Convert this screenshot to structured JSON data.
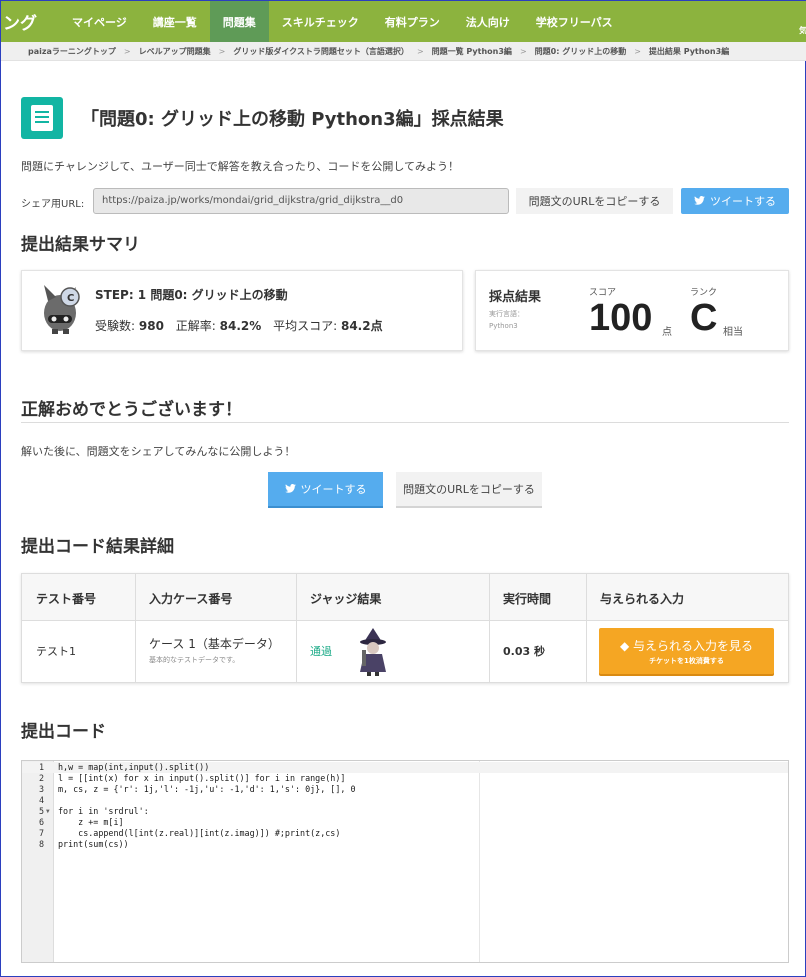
{
  "nav": {
    "logo": "ング",
    "items": [
      "マイページ",
      "講座一覧",
      "問題集",
      "スキルチェック",
      "有料プラン",
      "法人向け",
      "学校フリーパス"
    ],
    "active_index": 2,
    "right_text": "気"
  },
  "breadcrumb": [
    "paizaラーニングトップ",
    "レベルアップ問題集",
    "グリッド版ダイクストラ問題セット（言語選択）",
    "問題一覧 Python3編",
    "問題0: グリッド上の移動",
    "提出結果 Python3編"
  ],
  "title": "「問題0: グリッド上の移動 Python3編」採点結果",
  "intro": "問題にチャレンジして、ユーザー同士で解答を教え合ったり、コードを公開してみよう！",
  "share": {
    "label": "シェア用URL:",
    "url": "https://paiza.jp/works/mondai/grid_dijkstra/grid_dijkstra__d0",
    "copy_label": "問題文のURLをコピーする",
    "tweet_label": "ツイートする"
  },
  "summary": {
    "heading": "提出結果サマリ",
    "step_title": "STEP: 1 問題0: グリッド上の移動",
    "examinees_label": "受験数:",
    "examinees": "980",
    "accuracy_label": "正解率:",
    "accuracy": "84.2%",
    "avg_label": "平均スコア:",
    "avg": "84.2点",
    "result_title": "採点結果",
    "lang_label": "実行言語：",
    "lang": "Python3",
    "score_label": "スコア",
    "score": "100",
    "score_unit": "点",
    "rank_label": "ランク",
    "rank": "C",
    "rank_unit": "相当"
  },
  "congrats": {
    "heading": "正解おめでとうございます！",
    "prompt": "解いた後に、問題文をシェアしてみんなに公開しよう！",
    "tweet_label": "ツイートする",
    "copy_label": "問題文のURLをコピーする"
  },
  "details": {
    "heading": "提出コード結果詳細",
    "columns": [
      "テスト番号",
      "入力ケース番号",
      "ジャッジ結果",
      "実行時間",
      "与えられる入力"
    ],
    "rows": [
      {
        "test": "テスト1",
        "case": "ケース 1（基本データ）",
        "case_desc": "基本的なテストデータです。",
        "judge": "通過",
        "time": "0.03 秒",
        "button_main": "与えられる入力を見る",
        "button_sub": "チケットを1枚消費する"
      }
    ]
  },
  "code": {
    "heading": "提出コード",
    "lines": [
      "h,w = map(int,input().split())",
      "l = [[int(x) for x in input().split()] for i in range(h)]",
      "m, cs, z = {'r': 1j,'l': -1j,'u': -1,'d': 1,'s': 0j}, [], 0",
      "",
      "for i in 'srdrul':",
      "    z += m[i]",
      "    cs.append(l[int(z.real)][int(z.imag)]) #;print(z,cs)",
      "print(sum(cs))"
    ]
  },
  "colors": {
    "nav_bg": "#8cb33e",
    "nav_active": "#5f9b57",
    "tweet": "#55acee",
    "accent": "#12b5a3",
    "pass": "#1dab88",
    "orange": "#f5a623"
  }
}
